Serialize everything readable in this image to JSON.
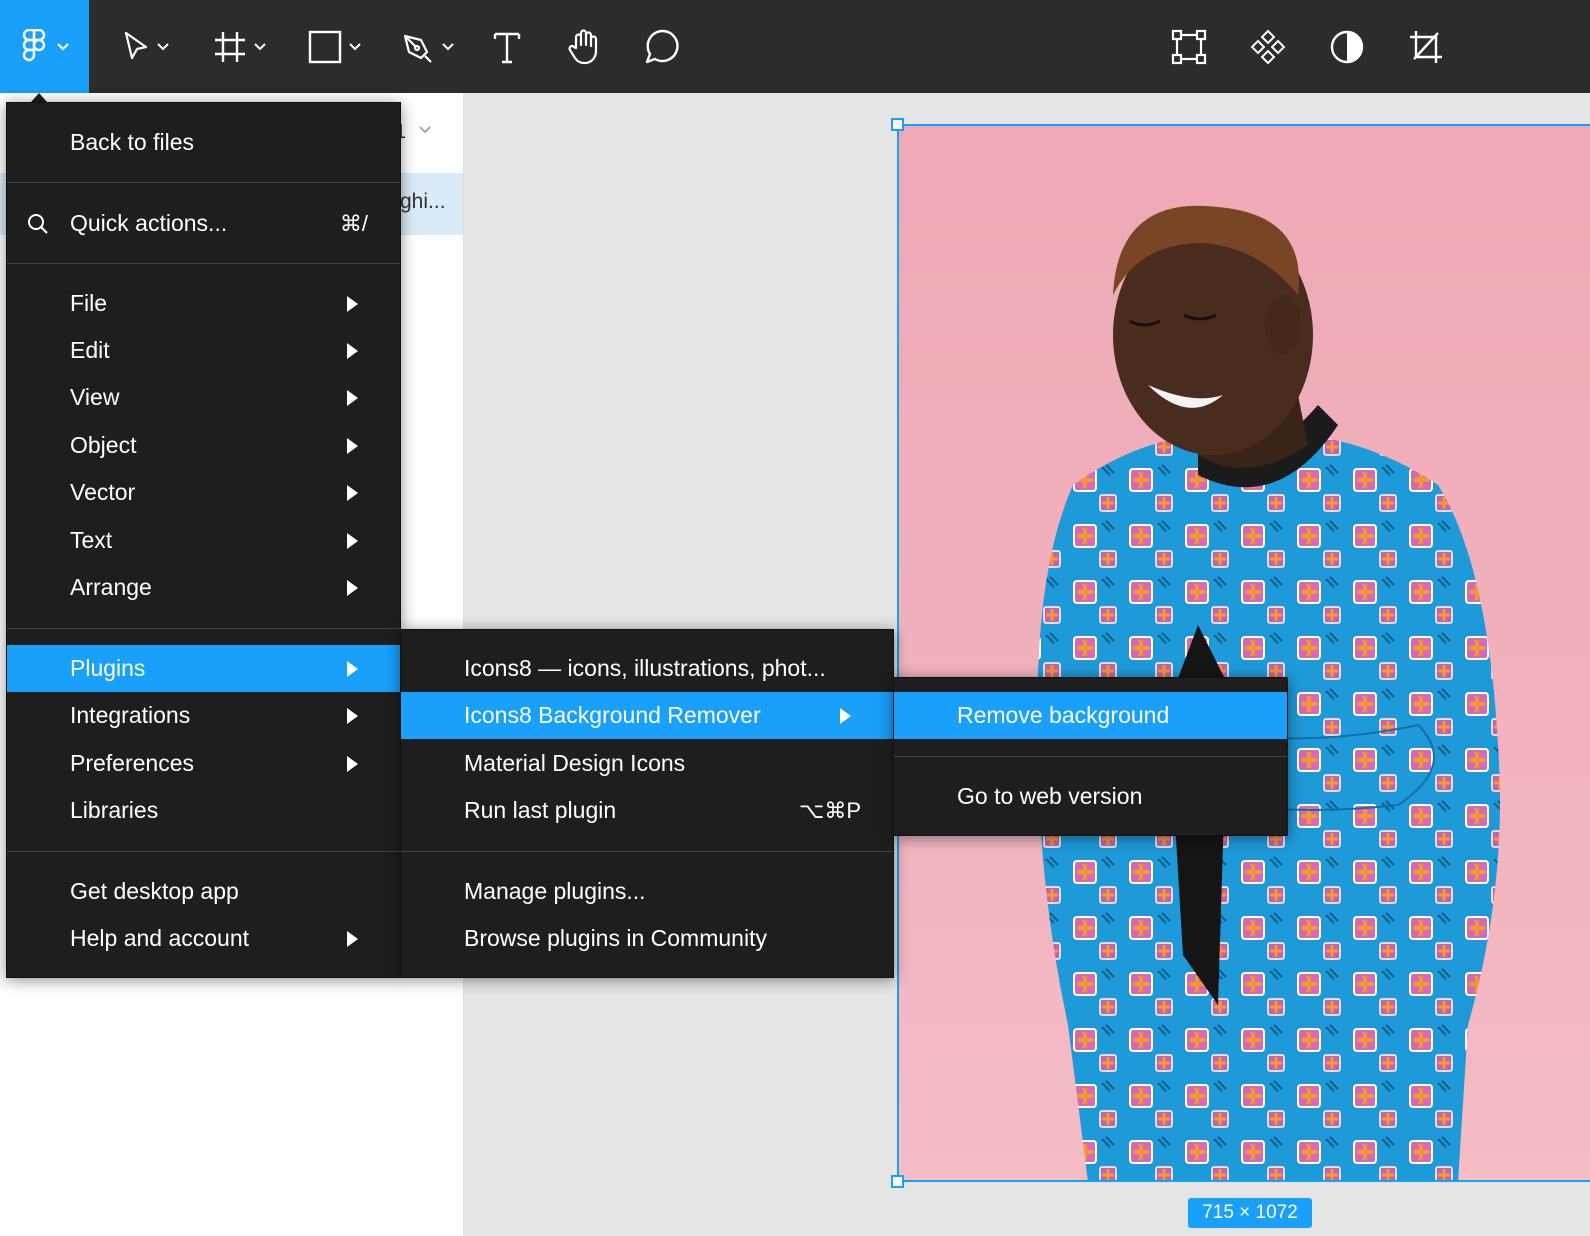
{
  "toolbar": {
    "main_icon": "figma-logo-icon",
    "tools": [
      "move-tool-icon",
      "frame-tool-icon",
      "rectangle-tool-icon",
      "pen-tool-icon",
      "text-tool-icon",
      "hand-tool-icon",
      "comment-tool-icon"
    ],
    "right_tools": [
      "transform-icon",
      "component-icon",
      "contrast-icon",
      "crop-icon"
    ]
  },
  "left_panel": {
    "page_fragment": "1",
    "layer_fragment": "ghi..."
  },
  "main_menu": {
    "back": "Back to files",
    "quick_actions": {
      "label": "Quick actions...",
      "shortcut": "⌘/"
    },
    "items": [
      {
        "label": "File",
        "submenu": true
      },
      {
        "label": "Edit",
        "submenu": true
      },
      {
        "label": "View",
        "submenu": true
      },
      {
        "label": "Object",
        "submenu": true
      },
      {
        "label": "Vector",
        "submenu": true
      },
      {
        "label": "Text",
        "submenu": true
      },
      {
        "label": "Arrange",
        "submenu": true
      }
    ],
    "items2": [
      {
        "label": "Plugins",
        "submenu": true,
        "active": true
      },
      {
        "label": "Integrations",
        "submenu": true
      },
      {
        "label": "Preferences",
        "submenu": true
      },
      {
        "label": "Libraries",
        "submenu": false
      }
    ],
    "items3": [
      {
        "label": "Get desktop app",
        "submenu": false
      },
      {
        "label": "Help and account",
        "submenu": true
      }
    ]
  },
  "plugins_menu": {
    "items": [
      {
        "label": "Icons8 — icons, illustrations, phot..."
      },
      {
        "label": "Icons8 Background Remover",
        "submenu": true,
        "active": true
      },
      {
        "label": "Material Design Icons"
      },
      {
        "label": "Run last plugin",
        "shortcut": "⌥⌘P"
      }
    ],
    "items2": [
      {
        "label": "Manage plugins..."
      },
      {
        "label": "Browse plugins in Community"
      }
    ]
  },
  "remover_menu": {
    "items": [
      {
        "label": "Remove background",
        "active": true
      },
      {
        "label": "Go to web version"
      }
    ]
  },
  "canvas": {
    "size_badge": "715 × 1072",
    "selection_color": "#18a0fb",
    "photo_bg_color": "#f0aeb9"
  }
}
